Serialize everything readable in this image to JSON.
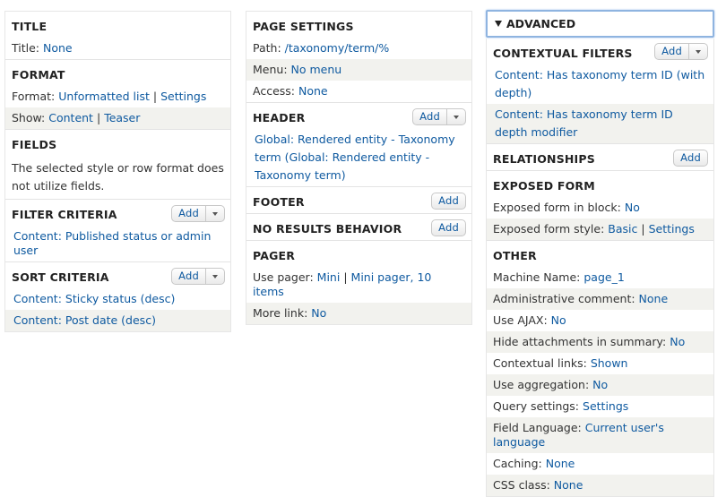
{
  "col1": {
    "title": {
      "heading": "TITLE",
      "label": "Title:",
      "value": "None"
    },
    "format": {
      "heading": "FORMAT",
      "format_label": "Format:",
      "format_value": "Unformatted list",
      "settings": "Settings",
      "show_label": "Show:",
      "show_value": "Content",
      "teaser": "Teaser"
    },
    "fields": {
      "heading": "FIELDS",
      "text": "The selected style or row format does not utilize fields."
    },
    "filter": {
      "heading": "FILTER CRITERIA",
      "add": "Add",
      "items": [
        "Content: Published status or admin user"
      ]
    },
    "sort": {
      "heading": "SORT CRITERIA",
      "add": "Add",
      "items": [
        "Content: Sticky status (desc)",
        "Content: Post date (desc)"
      ]
    }
  },
  "col2": {
    "page": {
      "heading": "PAGE SETTINGS",
      "path_label": "Path:",
      "path_value": "/taxonomy/term/%",
      "menu_label": "Menu:",
      "menu_value": "No menu",
      "access_label": "Access:",
      "access_value": "None"
    },
    "header": {
      "heading": "HEADER",
      "add": "Add",
      "item": "Global: Rendered entity - Taxonomy term (Global: Rendered entity - Taxonomy term)"
    },
    "footer": {
      "heading": "FOOTER",
      "add": "Add"
    },
    "noresults": {
      "heading": "NO RESULTS BEHAVIOR",
      "add": "Add"
    },
    "pager": {
      "heading": "PAGER",
      "use_label": "Use pager:",
      "use_value": "Mini",
      "use_detail": "Mini pager, 10 items",
      "more_label": "More link:",
      "more_value": "No"
    }
  },
  "col3": {
    "advanced": "ADVANCED",
    "contextual": {
      "heading": "CONTEXTUAL FILTERS",
      "add": "Add",
      "items": [
        "Content: Has taxonomy term ID (with depth)",
        "Content: Has taxonomy term ID depth modifier"
      ]
    },
    "relationships": {
      "heading": "RELATIONSHIPS",
      "add": "Add"
    },
    "exposed": {
      "heading": "EXPOSED FORM",
      "block_label": "Exposed form in block:",
      "block_value": "No",
      "style_label": "Exposed form style:",
      "style_value": "Basic",
      "settings": "Settings"
    },
    "other": {
      "heading": "OTHER",
      "rows": [
        {
          "label": "Machine Name:",
          "value": "page_1"
        },
        {
          "label": "Administrative comment:",
          "value": "None"
        },
        {
          "label": "Use AJAX:",
          "value": "No"
        },
        {
          "label": "Hide attachments in summary:",
          "value": "No"
        },
        {
          "label": "Contextual links:",
          "value": "Shown"
        },
        {
          "label": "Use aggregation:",
          "value": "No"
        },
        {
          "label": "Query settings:",
          "value": "Settings"
        },
        {
          "label": "Field Language:",
          "value": "Current user's language"
        },
        {
          "label": "Caching:",
          "value": "None"
        },
        {
          "label": "CSS class:",
          "value": "None"
        }
      ]
    }
  }
}
